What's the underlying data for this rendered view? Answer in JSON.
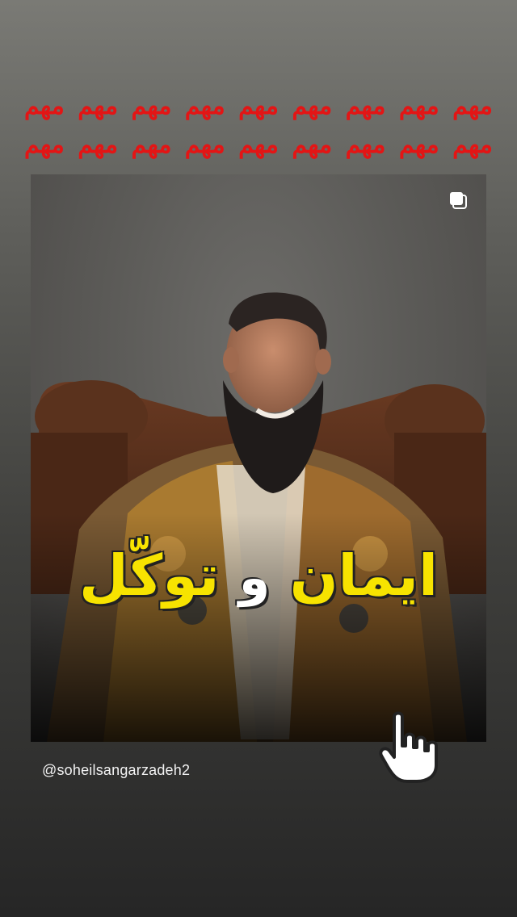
{
  "banner": {
    "row1": [
      "مهم",
      "مهم",
      "مهم",
      "مهم",
      "مهم",
      "مهم",
      "مهم",
      "مهم",
      "مهم"
    ],
    "row2": [
      "مهم",
      "مهم",
      "مهم",
      "مهم",
      "مهم",
      "مهم",
      "مهم",
      "مهم",
      "مهم"
    ],
    "color": "#e31515"
  },
  "post": {
    "multi_icon": "multiple-posts-icon",
    "overlay": {
      "word1": "ایمان",
      "word2": "و",
      "word3": "توکّل",
      "highlight_color": "#f7e300"
    }
  },
  "handle": "@soheilsangarzadeh2",
  "pointer_icon": "pointing-hand-icon"
}
